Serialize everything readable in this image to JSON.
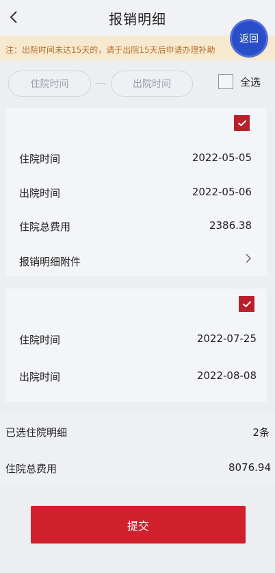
{
  "header": {
    "title": "报销明细",
    "back_icon": "chevron-left-icon"
  },
  "notice": {
    "text": "注：出院时间未达15天的，请于出院15天后申请办理补助"
  },
  "floating": {
    "return_label": "返回"
  },
  "filter": {
    "admission_placeholder": "住院时间",
    "discharge_placeholder": "出院时间",
    "select_all_label": "全选",
    "select_all_checked": false
  },
  "records": [
    {
      "checked": true,
      "admission_label": "住院时间",
      "admission_date": "2022-05-05",
      "discharge_label": "出院时间",
      "discharge_date": "2022-05-06",
      "cost_label": "住院总费用",
      "cost_value": "2386.38",
      "attachment_label": "报销明细附件"
    },
    {
      "checked": true,
      "admission_label": "住院时间",
      "admission_date": "2022-07-25",
      "discharge_label": "出院时间",
      "discharge_date": "2022-08-08"
    }
  ],
  "summary": {
    "selected_label": "已选住院明细",
    "selected_count": "2条",
    "total_label": "住院总费用",
    "total_value": "8076.94"
  },
  "actions": {
    "submit_label": "提交"
  },
  "colors": {
    "accent_red": "#d0202c",
    "return_blue": "#2a4ec9",
    "notice_bg": "#f6e9cf",
    "notice_text": "#b8702b"
  }
}
